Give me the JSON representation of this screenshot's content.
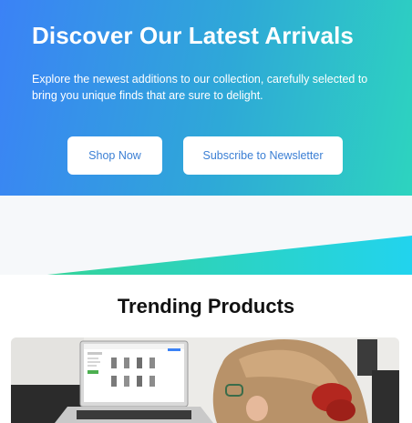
{
  "hero": {
    "title": "Discover Our Latest Arrivals",
    "subtitle": "Explore the newest additions to our collection, carefully selected to bring you unique finds that are sure to delight.",
    "primary_button": "Shop Now",
    "secondary_button": "Subscribe to Newsletter",
    "gradient_start": "#3b82f6",
    "gradient_end": "#2dd4bf"
  },
  "band": {
    "gradient_start": "#34d399",
    "gradient_end": "#22d3ee"
  },
  "trending": {
    "title": "Trending Products"
  },
  "colors": {
    "button_text": "#3b7fd4",
    "background": "#ffffff"
  }
}
